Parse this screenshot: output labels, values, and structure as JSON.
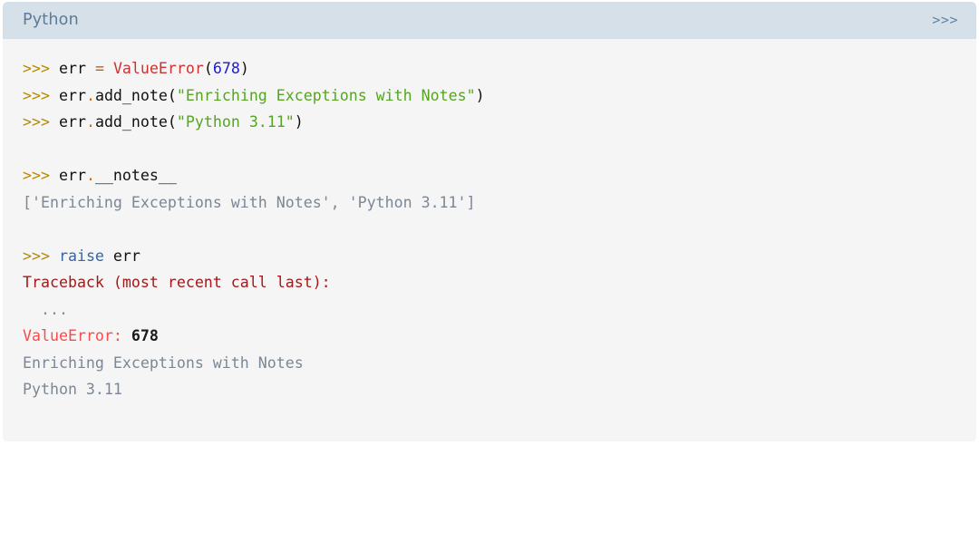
{
  "code_block": {
    "header": {
      "language": "Python",
      "prompt_badge": ">>>"
    },
    "lines": [
      {
        "id": "line-1",
        "tokens": [
          {
            "cls": "t-prompt",
            "text": ">>> "
          },
          {
            "cls": "t-plain",
            "text": "err "
          },
          {
            "cls": "t-op",
            "text": "="
          },
          {
            "cls": "t-plain",
            "text": " "
          },
          {
            "cls": "t-class",
            "text": "ValueError"
          },
          {
            "cls": "t-punct",
            "text": "("
          },
          {
            "cls": "t-number",
            "text": "678"
          },
          {
            "cls": "t-punct",
            "text": ")"
          }
        ]
      },
      {
        "id": "line-2",
        "tokens": [
          {
            "cls": "t-prompt",
            "text": ">>> "
          },
          {
            "cls": "t-plain",
            "text": "err"
          },
          {
            "cls": "t-dot",
            "text": "."
          },
          {
            "cls": "t-plain",
            "text": "add_note"
          },
          {
            "cls": "t-punct",
            "text": "("
          },
          {
            "cls": "t-string",
            "text": "\"Enriching Exceptions with Notes\""
          },
          {
            "cls": "t-punct",
            "text": ")"
          }
        ]
      },
      {
        "id": "line-3",
        "tokens": [
          {
            "cls": "t-prompt",
            "text": ">>> "
          },
          {
            "cls": "t-plain",
            "text": "err"
          },
          {
            "cls": "t-dot",
            "text": "."
          },
          {
            "cls": "t-plain",
            "text": "add_note"
          },
          {
            "cls": "t-punct",
            "text": "("
          },
          {
            "cls": "t-string",
            "text": "\"Python 3.11\""
          },
          {
            "cls": "t-punct",
            "text": ")"
          }
        ]
      },
      {
        "id": "line-4",
        "blank": true,
        "tokens": []
      },
      {
        "id": "line-5",
        "tokens": [
          {
            "cls": "t-prompt",
            "text": ">>> "
          },
          {
            "cls": "t-plain",
            "text": "err"
          },
          {
            "cls": "t-dot",
            "text": "."
          },
          {
            "cls": "t-plain",
            "text": "__notes__"
          }
        ]
      },
      {
        "id": "line-6",
        "tokens": [
          {
            "cls": "t-output",
            "text": "['Enriching Exceptions with Notes', 'Python 3.11']"
          }
        ]
      },
      {
        "id": "line-7",
        "blank": true,
        "tokens": []
      },
      {
        "id": "line-8",
        "tokens": [
          {
            "cls": "t-prompt",
            "text": ">>> "
          },
          {
            "cls": "t-keyword",
            "text": "raise"
          },
          {
            "cls": "t-plain",
            "text": " err"
          }
        ]
      },
      {
        "id": "line-9",
        "tokens": [
          {
            "cls": "t-tb",
            "text": "Traceback (most recent call last):"
          }
        ]
      },
      {
        "id": "line-10",
        "tokens": [
          {
            "cls": "t-ellipsis",
            "text": "  ..."
          }
        ]
      },
      {
        "id": "line-11",
        "tokens": [
          {
            "cls": "t-errname",
            "text": "ValueError"
          },
          {
            "cls": "t-colon",
            "text": ":"
          },
          {
            "cls": "t-errval",
            "text": " 678"
          }
        ]
      },
      {
        "id": "line-12",
        "tokens": [
          {
            "cls": "t-output",
            "text": "Enriching Exceptions with Notes"
          }
        ]
      },
      {
        "id": "line-13",
        "tokens": [
          {
            "cls": "t-output",
            "text": "Python 3.11"
          }
        ]
      }
    ]
  },
  "colors": {
    "header_background": "#d5e0e9",
    "header_text": "#5b7c99",
    "body_background": "#f5f5f5",
    "prompt": "#b58900",
    "string": "#57a423",
    "class_name": "#d03030",
    "number": "#1c1cd0",
    "keyword": "#3465a4",
    "operator": "#c4620a",
    "output_text": "#7b8794",
    "traceback": "#a61717",
    "error_name": "#fa4a4a"
  }
}
